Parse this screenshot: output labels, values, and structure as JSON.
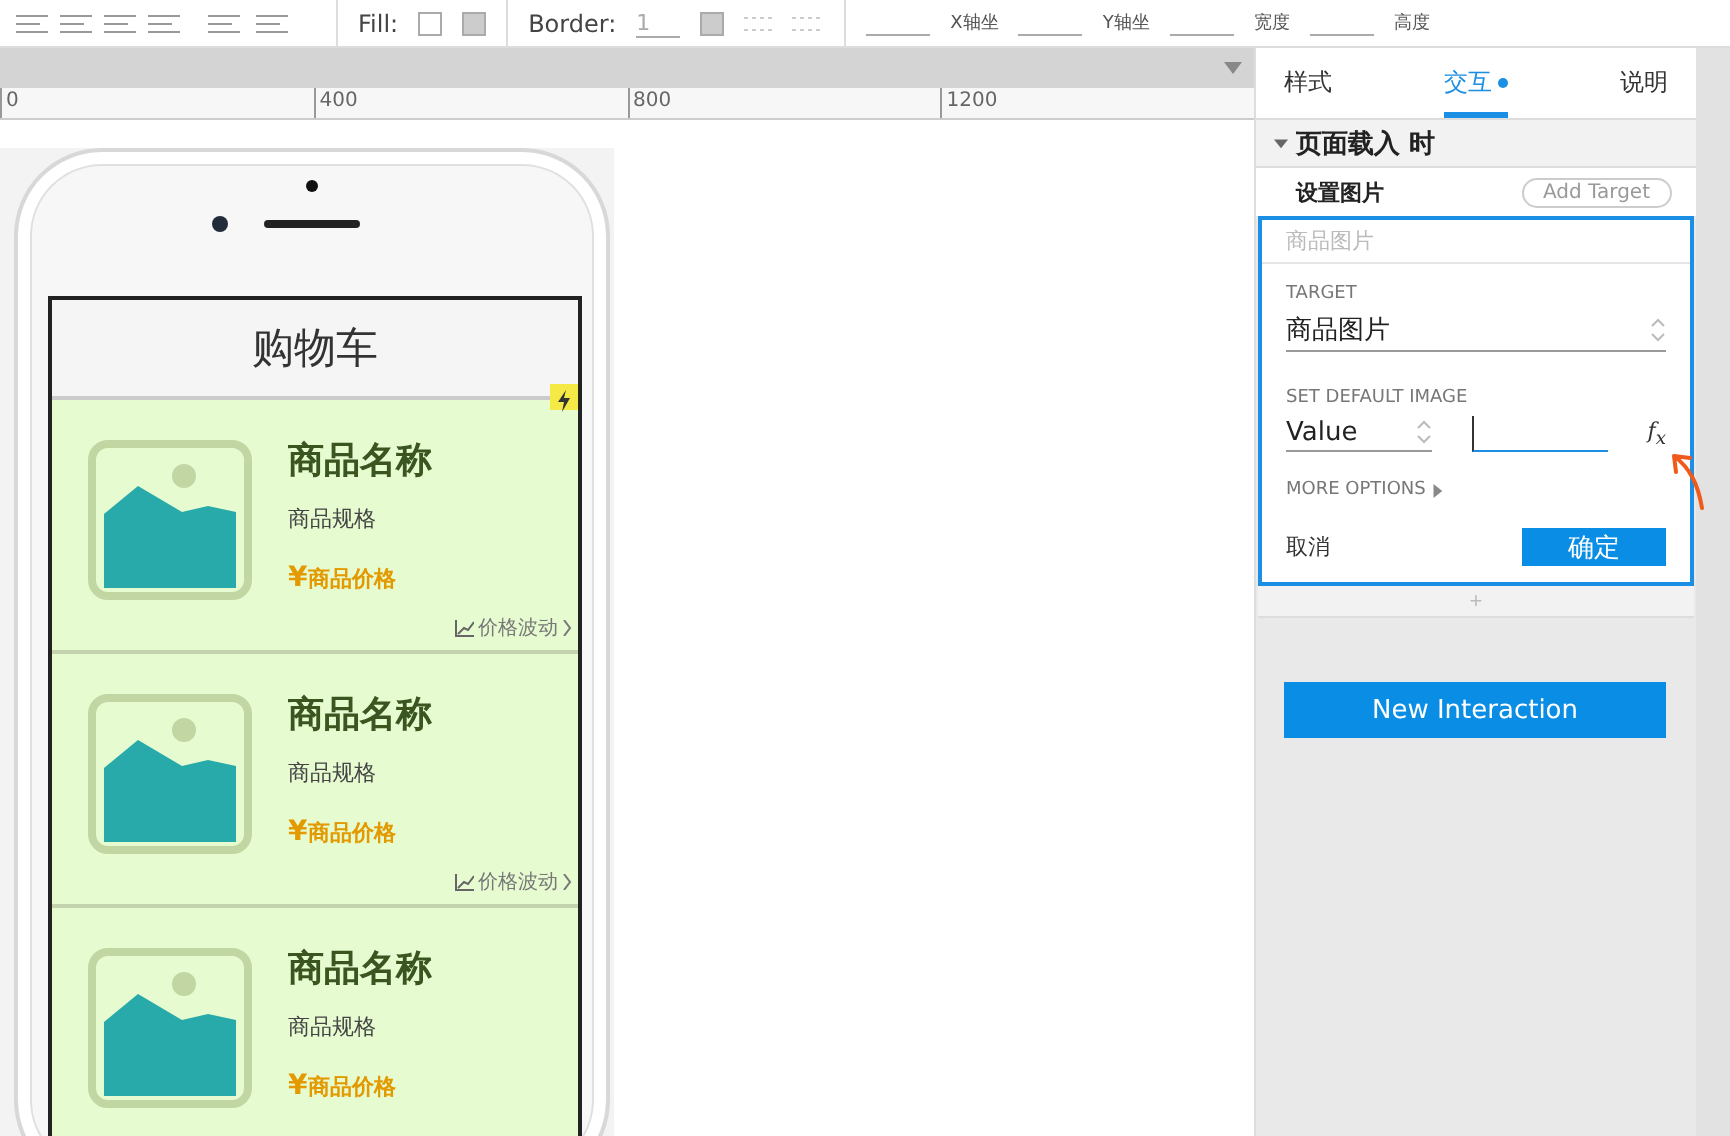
{
  "toolbar": {
    "fill_label": "Fill:",
    "border_label": "Border:",
    "border_value": "1",
    "coord_labels": [
      "X轴坐",
      "Y轴坐",
      "宽度",
      "高度"
    ]
  },
  "ruler": {
    "ticks": [
      "0",
      "400",
      "800",
      "1200"
    ]
  },
  "phone": {
    "title": "购物车",
    "products": [
      {
        "name": "商品名称",
        "spec": "商品规格",
        "currency": "¥",
        "price": "商品价格",
        "trend": "价格波动"
      },
      {
        "name": "商品名称",
        "spec": "商品规格",
        "currency": "¥",
        "price": "商品价格",
        "trend": "价格波动"
      },
      {
        "name": "商品名称",
        "spec": "商品规格",
        "currency": "¥",
        "price": "商品价格"
      }
    ]
  },
  "panel": {
    "tabs": [
      {
        "label": "样式",
        "selected": false,
        "dot": false
      },
      {
        "label": "交互",
        "selected": true,
        "dot": true
      },
      {
        "label": "说明",
        "selected": false,
        "dot": false
      }
    ],
    "event": {
      "title": "页面载入 时",
      "expanded": true
    },
    "action": {
      "label": "设置图片",
      "add_target": "Add Target"
    },
    "editor": {
      "target_summary": "商品图片",
      "target_label": "TARGET",
      "target_value": "商品图片",
      "image_label": "SET DEFAULT IMAGE",
      "image_mode": "Value",
      "fx": "f$_{x}$",
      "more_options": "MORE OPTIONS",
      "cancel": "取消",
      "ok": "确定"
    },
    "add": "+",
    "new_interaction": "New Interaction"
  }
}
